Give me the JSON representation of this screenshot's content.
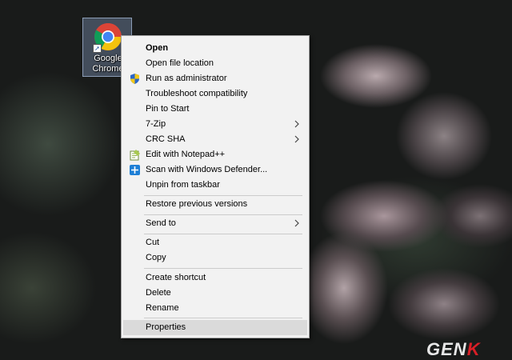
{
  "desktop": {
    "icon_label": "Google\nChrome"
  },
  "context_menu": {
    "items": [
      {
        "label": "Open",
        "bold": true
      },
      {
        "label": "Open file location"
      },
      {
        "label": "Run as administrator",
        "icon": "shield-icon"
      },
      {
        "label": "Troubleshoot compatibility"
      },
      {
        "label": "Pin to Start"
      },
      {
        "label": "7-Zip",
        "submenu": true
      },
      {
        "label": "CRC SHA",
        "submenu": true
      },
      {
        "label": "Edit with Notepad++",
        "icon": "notepadpp-icon"
      },
      {
        "label": "Scan with Windows Defender...",
        "icon": "defender-icon"
      },
      {
        "label": "Unpin from taskbar"
      },
      {
        "label": "Restore previous versions"
      },
      {
        "label": "Send to",
        "submenu": true
      },
      {
        "label": "Cut"
      },
      {
        "label": "Copy"
      },
      {
        "label": "Create shortcut"
      },
      {
        "label": "Delete"
      },
      {
        "label": "Rename"
      },
      {
        "label": "Properties",
        "highlighted": true
      }
    ]
  },
  "watermark": {
    "text_main": "GEN",
    "text_accent": "K"
  },
  "colors": {
    "menu_background": "#f2f2f2",
    "menu_highlight": "#dadada",
    "selection": "#7f92b0"
  }
}
